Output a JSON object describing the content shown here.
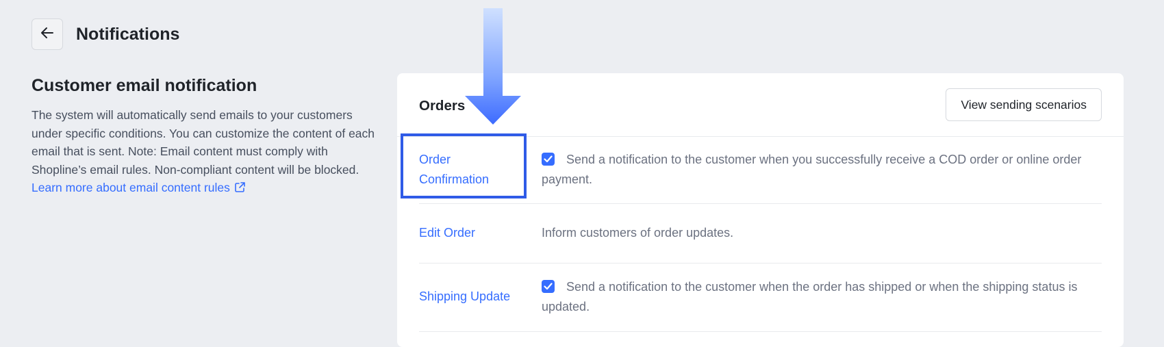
{
  "header": {
    "title": "Notifications",
    "back_icon": "arrow-left-icon"
  },
  "section": {
    "title": "Customer email notification",
    "description": "The system will automatically send emails to your customers under specific conditions. You can customize the content of each email that is sent. Note: Email content must comply with Shopline’s email rules. Non-compliant content will be blocked.",
    "link_text": "Learn more about email content rules",
    "link_icon": "external-link-icon"
  },
  "card": {
    "title": "Orders",
    "button_label": "View sending scenarios",
    "rows": [
      {
        "name": "Order Confirmation",
        "checked": true,
        "description": "Send a notification to the customer when you successfully receive a COD order or online order payment."
      },
      {
        "name": "Edit Order",
        "checked": false,
        "description": "Inform customers of order updates."
      },
      {
        "name": "Shipping Update",
        "checked": true,
        "description": "Send a notification to the customer when the order has shipped or when the shipping status is updated."
      }
    ]
  },
  "colors": {
    "background": "#ECEEF2",
    "link": "#356DFF",
    "highlight": "#2F5BE7"
  }
}
